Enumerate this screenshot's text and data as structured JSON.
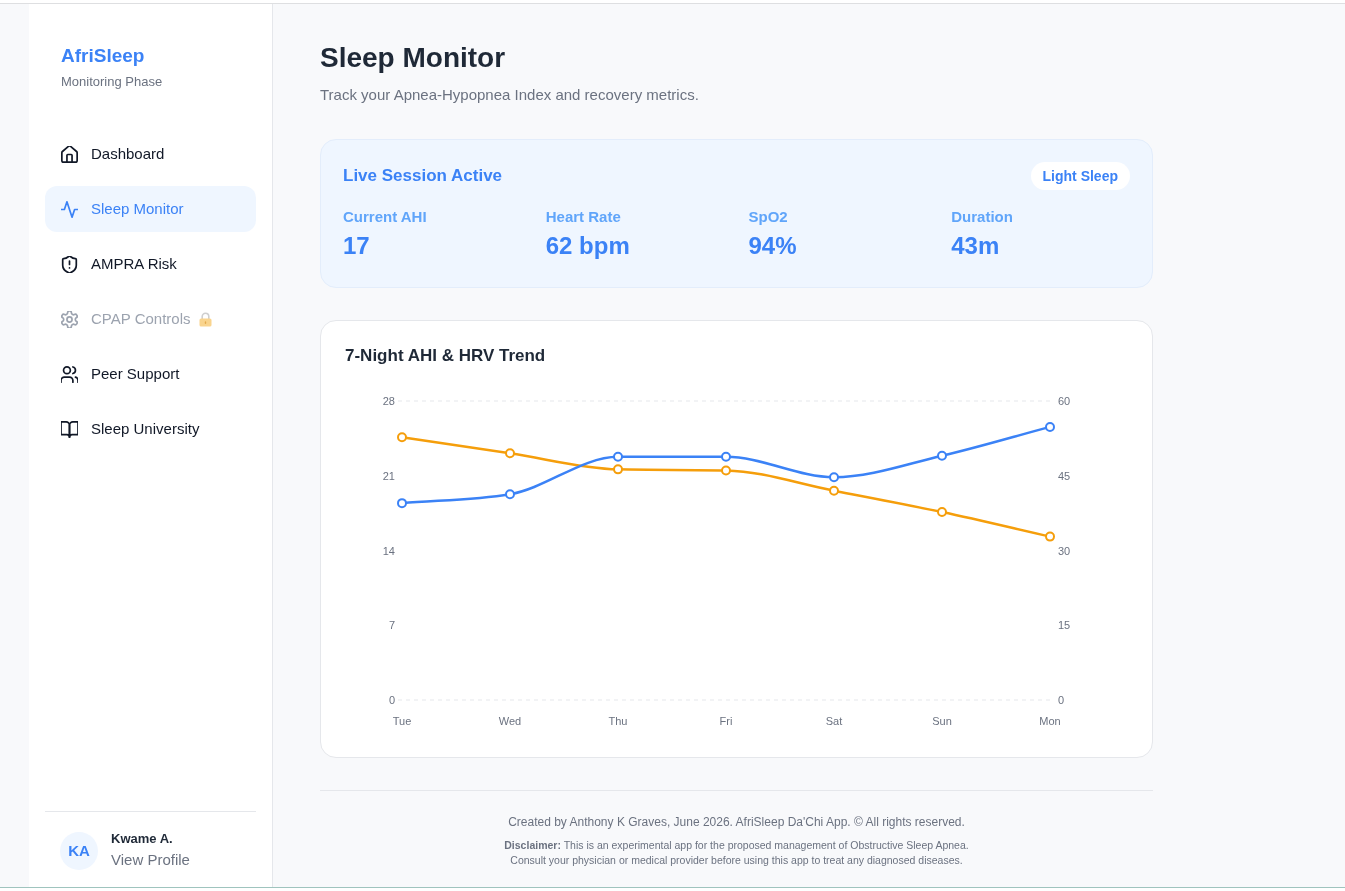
{
  "sidebar": {
    "brand": "AfriSleep",
    "phase": "Monitoring Phase",
    "items": [
      {
        "label": "Dashboard",
        "selected": false,
        "disabled": false
      },
      {
        "label": "Sleep Monitor",
        "selected": true,
        "disabled": false
      },
      {
        "label": "AMPRA Risk",
        "selected": false,
        "disabled": false
      },
      {
        "label": "CPAP Controls",
        "selected": false,
        "disabled": true
      },
      {
        "label": "Peer Support",
        "selected": false,
        "disabled": false
      },
      {
        "label": "Sleep University",
        "selected": false,
        "disabled": false
      }
    ],
    "profile": {
      "initials": "KA",
      "name": "Kwame A.",
      "link": "View Profile"
    }
  },
  "header": {
    "title": "Sleep Monitor",
    "subtitle": "Track your Apnea-Hypopnea Index and recovery metrics."
  },
  "live_session": {
    "title": "Live Session Active",
    "stage": "Light Sleep",
    "metrics": [
      {
        "label": "Current AHI",
        "value": "17"
      },
      {
        "label": "Heart Rate",
        "value": "62 bpm"
      },
      {
        "label": "SpO2",
        "value": "94%"
      },
      {
        "label": "Duration",
        "value": "43m"
      }
    ]
  },
  "trend": {
    "title": "7-Night AHI & HRV Trend",
    "chart_data": {
      "type": "line",
      "categories": [
        "Tue",
        "Wed",
        "Thu",
        "Fri",
        "Sat",
        "Sun",
        "Mon"
      ],
      "series": [
        {
          "color": "#f59e0b",
          "axis": "y",
          "marker": "circle",
          "values": [
            24.6,
            23.1,
            21.6,
            21.5,
            19.6,
            17.6,
            15.3
          ]
        },
        {
          "color": "#3b82f6",
          "axis": "y2",
          "marker": "circle",
          "values": [
            39.5,
            41.3,
            48.8,
            48.8,
            44.7,
            49.0,
            54.8
          ]
        }
      ],
      "ylim": [
        0,
        28
      ],
      "yticks": [
        0,
        7,
        14,
        21,
        28
      ],
      "y2lim": [
        0,
        60
      ],
      "y2ticks": [
        0,
        15,
        30,
        45,
        60
      ]
    }
  },
  "footer": {
    "credit": "Created by Anthony K Graves, June 2026. AfriSleep Da'Chi App. © All rights reserved.",
    "disclaimer": "**Disclaimer:** This is an experimental app for the proposed management of Obstructive Sleep Apnea. Consult your physician or medical provider before using this app to treat any diagnosed diseases."
  }
}
